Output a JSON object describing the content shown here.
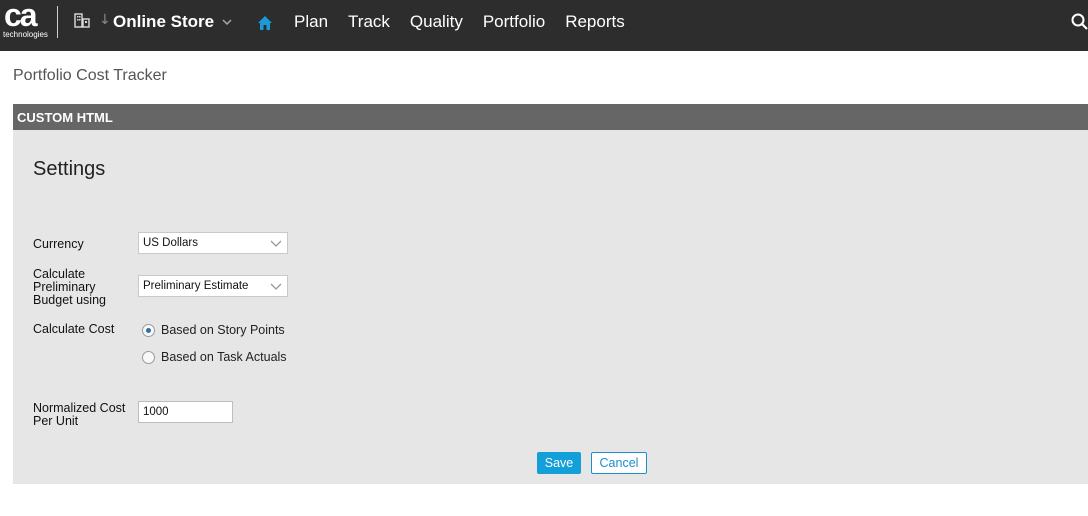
{
  "header": {
    "logo_text": "ca",
    "logo_subtext": "technologies",
    "workspace_icon": "building-icon",
    "workspace_name": "Online Store",
    "nav": {
      "home_icon": "home-icon",
      "items": [
        "Plan",
        "Track",
        "Quality",
        "Portfolio",
        "Reports"
      ]
    },
    "search_icon": "search-icon",
    "colors": {
      "bar": "#2d2d2d",
      "home_accent": "#1b9ad6"
    }
  },
  "page": {
    "title": "Portfolio Cost Tracker"
  },
  "panel": {
    "header": "CUSTOM HTML",
    "settings_title": "Settings",
    "currency": {
      "label": "Currency",
      "value": "US Dollars"
    },
    "preliminary": {
      "label_lines": [
        "Calculate",
        "Preliminary",
        "Budget using"
      ],
      "value": "Preliminary Estimate"
    },
    "cost": {
      "label": "Calculate Cost",
      "options": [
        {
          "label": "Based on Story Points",
          "selected": true
        },
        {
          "label": "Based on Task Actuals",
          "selected": false
        }
      ]
    },
    "normalized": {
      "label_lines": [
        "Normalized Cost",
        "Per Unit"
      ],
      "value": "1000"
    },
    "buttons": {
      "save": "Save",
      "cancel": "Cancel"
    },
    "colors": {
      "save_bg": "#13a0d8",
      "cancel_text": "#1b8fd0",
      "panel_bg": "#e6e6e6",
      "header_bg": "#666666"
    }
  }
}
